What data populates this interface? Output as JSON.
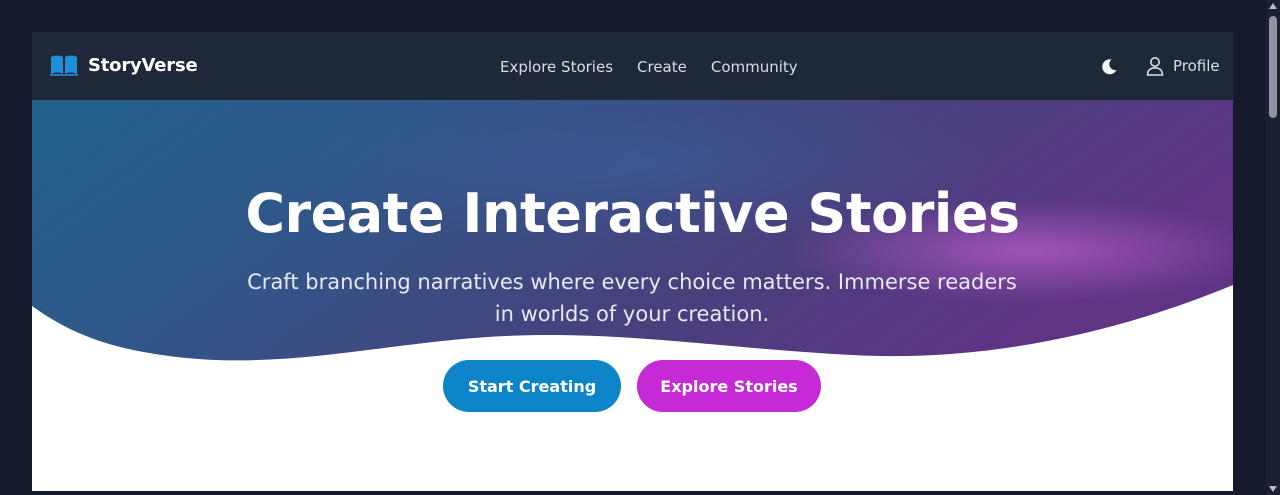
{
  "nav": {
    "brand": "StoryVerse",
    "brand_icon": "open-book-icon",
    "links": [
      "Explore Stories",
      "Create",
      "Community"
    ],
    "theme_icon": "moon-icon",
    "profile_icon": "user-icon",
    "profile_label": "Profile"
  },
  "hero": {
    "title": "Create Interactive Stories",
    "subtitle": "Craft branching narratives where every choice matters. Immerse readers in worlds of your creation.",
    "primary_cta": "Start Creating",
    "secondary_cta": "Explore Stories"
  },
  "colors": {
    "page_background": "#151b2c",
    "navbar": "#1f2838",
    "brand_icon": "#1e8fd8",
    "hero_gradient_start": "#245a86",
    "hero_gradient_end": "#5d3685",
    "primary_button": "#0e84c8",
    "secondary_button": "#c52ad6"
  }
}
